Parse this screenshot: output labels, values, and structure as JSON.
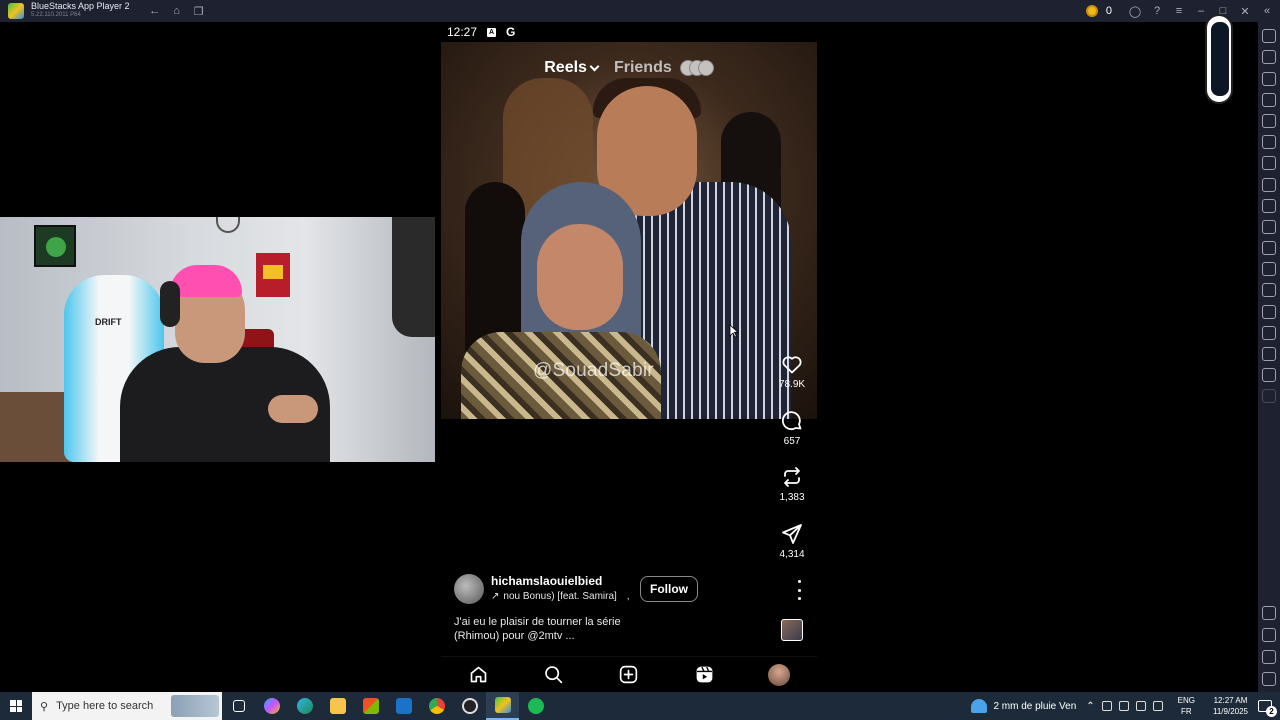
{
  "bluestacks": {
    "title": "BlueStacks App Player 2",
    "version": "5.22.110.2011 P64",
    "coins": "0",
    "accent": "#1d2130"
  },
  "phone": {
    "status_time": "12:27",
    "status_icons": [
      "A",
      "G"
    ],
    "tabs": {
      "reels": "Reels",
      "friends": "Friends"
    },
    "watermark": "@SouadSabir",
    "actions": [
      {
        "icon": "heart-icon",
        "count": "78.9K"
      },
      {
        "icon": "comment-icon",
        "count": "657"
      },
      {
        "icon": "repost-icon",
        "count": "1,383"
      },
      {
        "icon": "send-icon",
        "count": "4,314"
      }
    ],
    "author": {
      "username": "hichamslaouielbied",
      "audio": "nou Bonus) [feat. Samira]",
      "audio_sep": ",",
      "follow_label": "Follow"
    },
    "caption_line1": "J'ai eu le plaisir de tourner la série",
    "caption_line2": "(Rhimou) pour @2mtv ...",
    "nav": [
      "home-icon",
      "search-icon",
      "create-icon",
      "reels-icon",
      "profile-avatar"
    ]
  },
  "taskbar": {
    "search_placeholder": "Type here to search",
    "weather": "2 mm de pluie Ven",
    "lang_top": "ENG",
    "lang_bottom": "FR",
    "time": "12:27 AM",
    "date": "11/9/2025",
    "notifications": "2",
    "colors": {
      "bar": "#1c2a3a",
      "active": "#76b9ed"
    }
  },
  "webcam": {
    "chair_logo": "DRIFT"
  }
}
